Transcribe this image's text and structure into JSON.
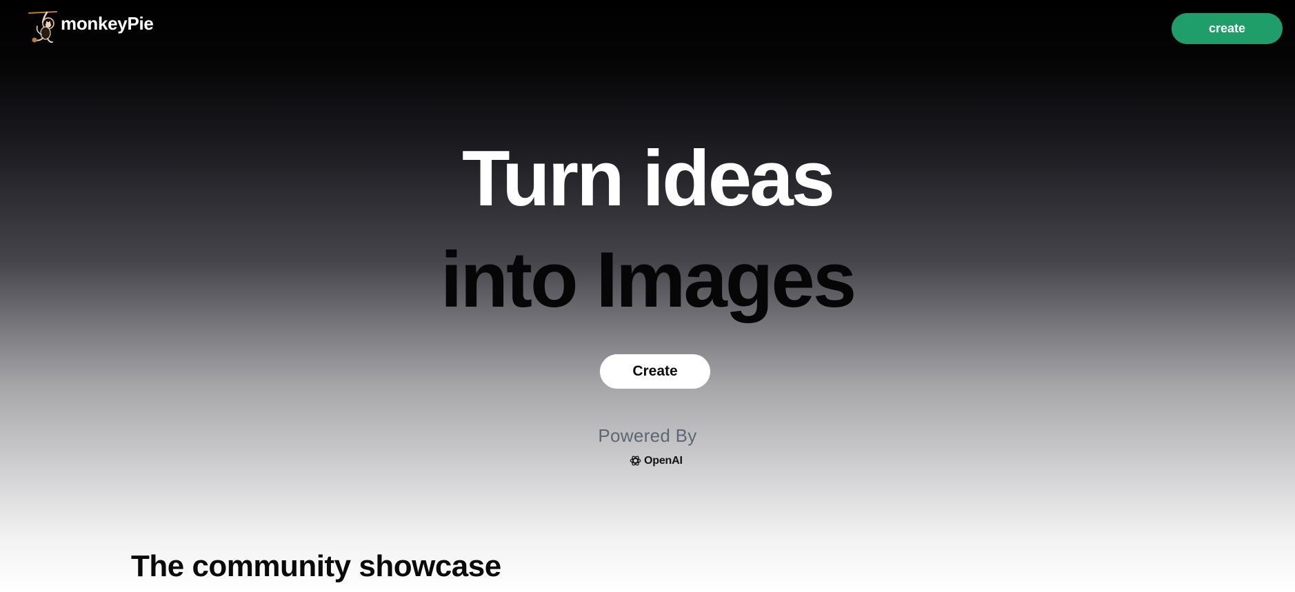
{
  "header": {
    "brand_name": "monkeyPie",
    "logo_icon": "monkey-icon",
    "create_label": "create"
  },
  "hero": {
    "title_line_1": "Turn ideas",
    "title_line_2": "into Images",
    "create_label": "Create",
    "powered_by": "Powered By",
    "provider_name": "OpenAI",
    "provider_icon": "openai-knot-icon"
  },
  "showcase": {
    "title": "The community showcase"
  },
  "colors": {
    "accent_green": "#1f9e6a",
    "gradient_top": "#000000",
    "gradient_bottom": "#ffffff",
    "muted_text": "#5e6673"
  }
}
